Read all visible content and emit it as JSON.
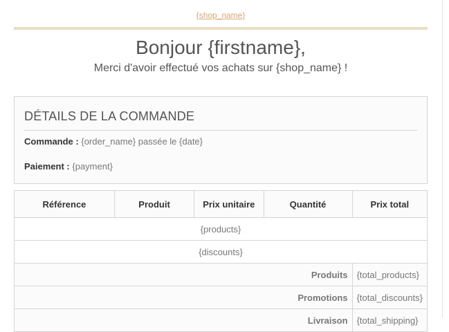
{
  "header": {
    "shop_link": "{shop_name}",
    "greeting": "Bonjour {firstname},",
    "thanks": "Merci d'avoir effectué vos achats sur {shop_name} !"
  },
  "details": {
    "title": "DÉTAILS DE LA COMMANDE",
    "order_label": "Commande :",
    "order_value": "{order_name} passée le {date}",
    "payment_label": "Paiement :",
    "payment_value": "{payment}"
  },
  "table": {
    "columns": [
      "Référence",
      "Produit",
      "Prix unitaire",
      "Quantité",
      "Prix total"
    ],
    "products_placeholder": "{products}",
    "discounts_placeholder": "{discounts}",
    "totals": [
      {
        "label": "Produits",
        "value": "{total_products}"
      },
      {
        "label": "Promotions",
        "value": "{total_discounts}"
      },
      {
        "label": "Livraison",
        "value": "{total_shipping}"
      }
    ]
  },
  "colors": {
    "accent": "#d6a76f",
    "rule": "#ebdcc3",
    "border": "#d6d4d4",
    "text": "#555454"
  }
}
